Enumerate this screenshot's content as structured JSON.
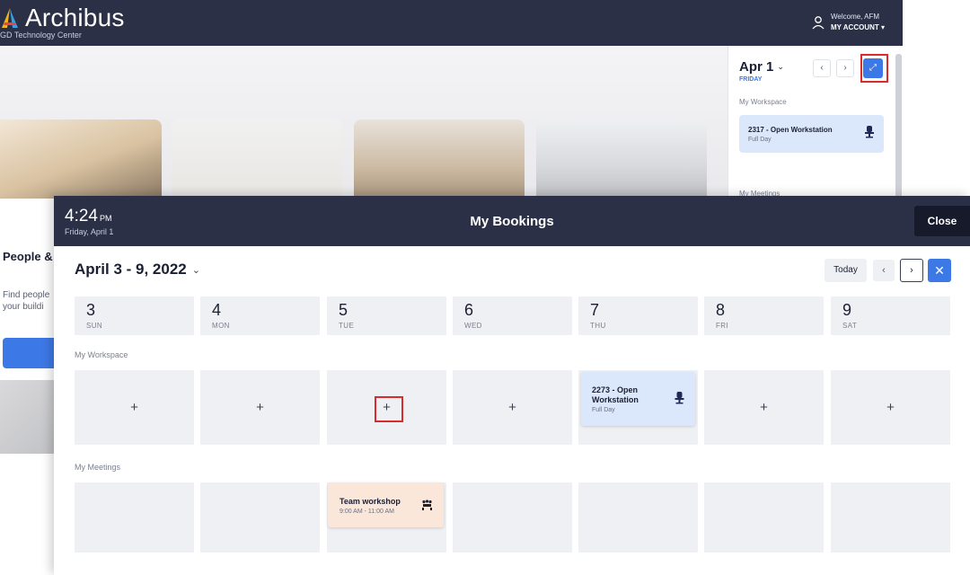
{
  "app": {
    "brand": "Archibus",
    "subtitle": "GD Technology Center",
    "welcome": "Welcome, AFM",
    "account": "MY ACCOUNT ▾"
  },
  "home": {
    "people_title": "People &",
    "people_desc_line1": "Find people",
    "people_desc_line2": "your buildi"
  },
  "side_panel": {
    "date": "Apr 1",
    "weekday": "FRIDAY",
    "prev": "‹",
    "next": "›",
    "expand": "⤢",
    "workspace_label": "My Workspace",
    "booking_title": "2317 - Open Workstation",
    "booking_sub": "Full Day",
    "booking_icon": "desk-chair-icon",
    "meetings_label": "My Meetings"
  },
  "bookings": {
    "time": "4:24",
    "ampm": "PM",
    "date": "Friday, April 1",
    "title": "My Bookings",
    "close": "Close",
    "week_range": "April 3 - 9, 2022",
    "week_chevron": "⌄",
    "today": "Today",
    "prev": "‹",
    "next": "›",
    "collapse": "✕",
    "days": [
      {
        "num": "3",
        "dow": "SUN"
      },
      {
        "num": "4",
        "dow": "MON"
      },
      {
        "num": "5",
        "dow": "TUE"
      },
      {
        "num": "6",
        "dow": "WED"
      },
      {
        "num": "7",
        "dow": "THU"
      },
      {
        "num": "8",
        "dow": "FRI"
      },
      {
        "num": "9",
        "dow": "SAT"
      }
    ],
    "workspace_label": "My Workspace",
    "meetings_label": "My Meetings",
    "plus": "+",
    "ws_booking": {
      "title": "2273 - Open Workstation",
      "sub": "Full Day",
      "icon": "desk-chair-icon"
    },
    "meeting": {
      "title": "Team workshop",
      "time": "9:00 AM - 11:00 AM",
      "icon": "meeting-room-icon"
    }
  },
  "colors": {
    "header": "#2b3047",
    "accent": "#3d79e6",
    "cell": "#eef0f4",
    "workspace_booking": "#dbe8fb",
    "meeting_booking": "#fbe7d9",
    "highlight": "#d92b2b"
  }
}
